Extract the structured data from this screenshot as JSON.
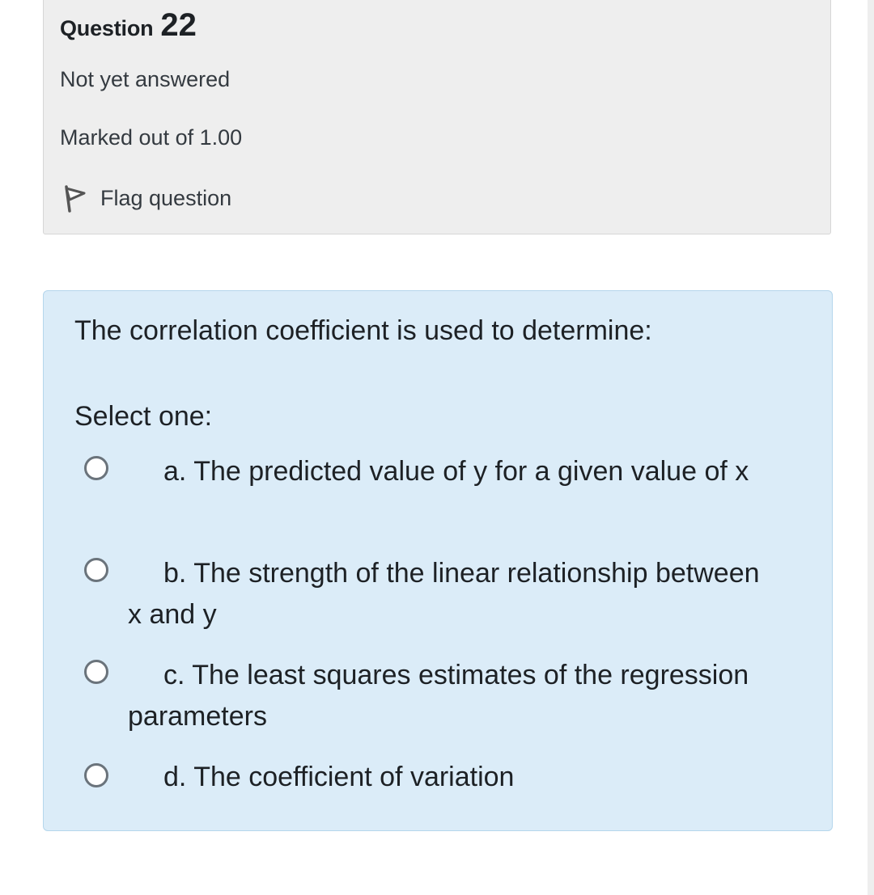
{
  "question": {
    "label": "Question",
    "number": "22",
    "status": "Not yet answered",
    "mark": "Marked out of 1.00",
    "flag_label": "Flag question",
    "text": "The correlation coefficient is used to determine:",
    "prompt": "Select one:",
    "options": [
      {
        "label": "a. The predicted value of y for a given value of x"
      },
      {
        "label": "b. The strength of the linear relationship between x and y"
      },
      {
        "label": "c. The least squares estimates of the regression parameters"
      },
      {
        "label": "d. The coefficient of variation"
      }
    ]
  },
  "icons": {
    "flag": "flag-icon",
    "radio": "radio-unselected-icon"
  },
  "colors": {
    "info_background": "#eeeeee",
    "question_background": "#dbecf8",
    "question_border": "#b5d6ec",
    "radio_border": "#6a737b",
    "text": "#1d2125"
  }
}
